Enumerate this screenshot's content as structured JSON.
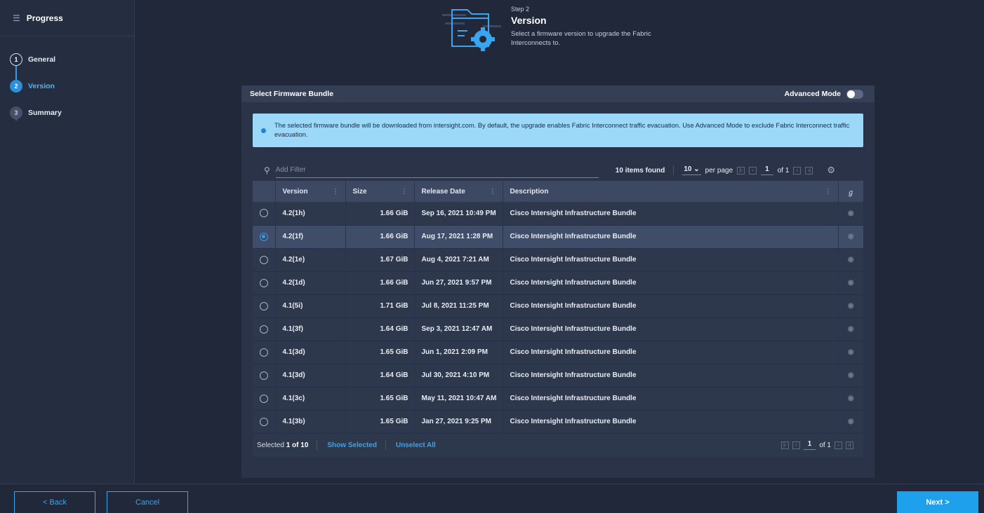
{
  "sidebar": {
    "title": "Progress",
    "steps": [
      {
        "num": "1",
        "label": "General"
      },
      {
        "num": "2",
        "label": "Version"
      },
      {
        "num": "3",
        "label": "Summary"
      }
    ]
  },
  "header": {
    "step_label": "Step 2",
    "title": "Version",
    "description": "Select a firmware version to upgrade the Fabric Interconnects to."
  },
  "panel": {
    "title": "Select Firmware Bundle",
    "advanced_mode_label": "Advanced Mode",
    "advanced_mode_on": false,
    "info_banner": "The selected firmware bundle will be downloaded from intersight.com. By default, the upgrade enables Fabric Interconnect traffic evacuation. Use Advanced Mode to exclude Fabric Interconnect traffic evacuation."
  },
  "table": {
    "filter_placeholder": "Add Filter",
    "items_found": "10 items found",
    "per_page_value": "10",
    "per_page_label": "per page",
    "page": "1",
    "of_pages": "of 1",
    "columns": [
      "Version",
      "Size",
      "Release Date",
      "Description"
    ],
    "rows": [
      {
        "version": "4.2(1h)",
        "size": "1.66 GiB",
        "date": "Sep 16, 2021 10:49 PM",
        "desc": "Cisco Intersight Infrastructure Bundle",
        "selected": false
      },
      {
        "version": "4.2(1f)",
        "size": "1.66 GiB",
        "date": "Aug 17, 2021 1:28 PM",
        "desc": "Cisco Intersight Infrastructure Bundle",
        "selected": true
      },
      {
        "version": "4.2(1e)",
        "size": "1.67 GiB",
        "date": "Aug 4, 2021 7:21 AM",
        "desc": "Cisco Intersight Infrastructure Bundle",
        "selected": false
      },
      {
        "version": "4.2(1d)",
        "size": "1.66 GiB",
        "date": "Jun 27, 2021 9:57 PM",
        "desc": "Cisco Intersight Infrastructure Bundle",
        "selected": false
      },
      {
        "version": "4.1(5i)",
        "size": "1.71 GiB",
        "date": "Jul 8, 2021 11:25 PM",
        "desc": "Cisco Intersight Infrastructure Bundle",
        "selected": false
      },
      {
        "version": "4.1(3f)",
        "size": "1.64 GiB",
        "date": "Sep 3, 2021 12:47 AM",
        "desc": "Cisco Intersight Infrastructure Bundle",
        "selected": false
      },
      {
        "version": "4.1(3d)",
        "size": "1.65 GiB",
        "date": "Jun 1, 2021 2:09 PM",
        "desc": "Cisco Intersight Infrastructure Bundle",
        "selected": false
      },
      {
        "version": "4.1(3d)",
        "size": "1.64 GiB",
        "date": "Jul 30, 2021 4:10 PM",
        "desc": "Cisco Intersight Infrastructure Bundle",
        "selected": false
      },
      {
        "version": "4.1(3c)",
        "size": "1.65 GiB",
        "date": "May 11, 2021 10:47 AM",
        "desc": "Cisco Intersight Infrastructure Bundle",
        "selected": false
      },
      {
        "version": "4.1(3b)",
        "size": "1.65 GiB",
        "date": "Jan 27, 2021 9:25 PM",
        "desc": "Cisco Intersight Infrastructure Bundle",
        "selected": false
      }
    ],
    "footer": {
      "selected_prefix": "Selected",
      "selected_count": "1 of 10",
      "show_selected": "Show Selected",
      "unselect_all": "Unselect All",
      "page": "1",
      "of_pages": "of 1"
    }
  },
  "footer": {
    "back_label": "< Back",
    "cancel_label": "Cancel",
    "next_label": "Next >"
  },
  "colors": {
    "accent": "#1fa0ec",
    "background": "#20283a",
    "banner": "#9cd9f8"
  }
}
